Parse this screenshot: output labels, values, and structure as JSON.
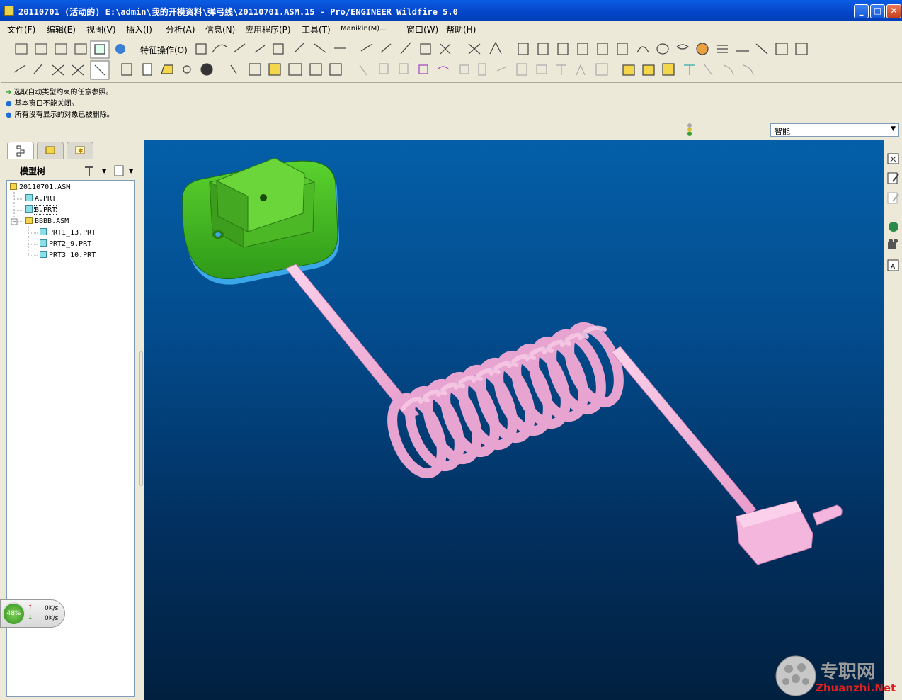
{
  "window": {
    "title": "20110701 (活动的) E:\\admin\\我的开模资料\\弹弓线\\20110701.ASM.15 - Pro/ENGINEER Wildfire 5.0",
    "minimize": "_",
    "maximize": "□",
    "close": "✕"
  },
  "menu": {
    "items": [
      "文件(F)",
      "编辑(E)",
      "视图(V)",
      "插入(I)",
      "分析(A)",
      "信息(N)",
      "应用程序(P)",
      "工具(T)",
      "Manikin(M)...",
      "窗口(W)",
      "帮助(H)"
    ]
  },
  "toolbar": {
    "feature_ops": "特征操作(O)"
  },
  "messages": [
    {
      "icon": "arrow",
      "text": "选取自动类型约束的任意参照。"
    },
    {
      "icon": "bullet",
      "text": "基本窗口不能关闭。"
    },
    {
      "icon": "bullet",
      "text": "所有没有显示的对象已被删除。"
    }
  ],
  "filter": {
    "value": "智能"
  },
  "model_tree": {
    "label": "模型树",
    "nodes": [
      {
        "text": "20110701.ASM",
        "type": "asm"
      },
      {
        "text": "A.PRT",
        "type": "prt"
      },
      {
        "text": "B.PRT",
        "type": "prt"
      },
      {
        "text": "BBBB.ASM",
        "type": "asm"
      },
      {
        "text": "PRT1_13.PRT",
        "type": "prt"
      },
      {
        "text": "PRT2_9.PRT",
        "type": "prt"
      },
      {
        "text": "PRT3_10.PRT",
        "type": "prt"
      }
    ]
  },
  "net_widget": {
    "percent": "48%",
    "up": "0K/s",
    "down": "0K/s"
  },
  "watermark": {
    "cn": "专职网",
    "en": "Zhuanzhi.Net"
  },
  "colors": {
    "title_bar": "#0444c8",
    "viewport_top": "#045fa8",
    "viewport_bottom": "#01203f",
    "part_green": "#4cc02a",
    "spring_pink": "#f4b6dc"
  }
}
